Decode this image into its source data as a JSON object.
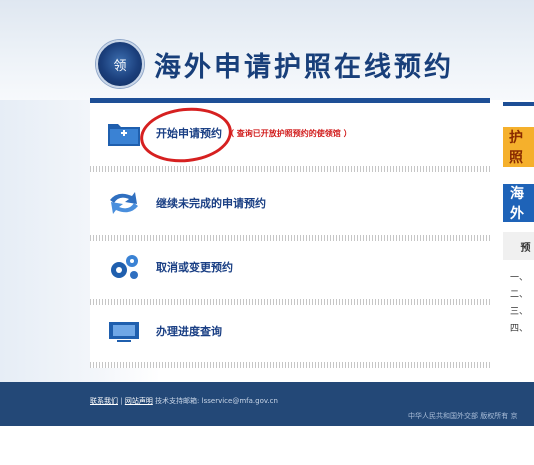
{
  "header": {
    "title": "海外申请护照在线预约",
    "emblem_text": "领"
  },
  "menu": [
    {
      "label": "开始申请预约",
      "sub": "（ 查询已开放护照预约的使领馆 ）",
      "icon": "folder-add-icon"
    },
    {
      "label": "继续未完成的申请预约",
      "icon": "refresh-arrows-icon"
    },
    {
      "label": "取消或变更预约",
      "icon": "gears-icon"
    },
    {
      "label": "办理进度查询",
      "icon": "monitor-icon"
    }
  ],
  "right_panel": {
    "yellow_label": "护照",
    "blue_label": "海外",
    "grey_header": "预",
    "list_items": [
      "一、",
      "二、",
      "三、",
      "四、"
    ]
  },
  "footer": {
    "link1": "联系我们",
    "sep": "|",
    "link2": "网站声明",
    "support_prefix": "技术支持邮箱:",
    "support_email": "lsservice@mfa.gov.cn",
    "copyright": "中华人民共和国外交部 版权所有 京"
  },
  "colors": {
    "accent": "#1e4f96",
    "footer_bg": "#234877",
    "yellow": "#f5b02c",
    "red": "#d62020"
  }
}
